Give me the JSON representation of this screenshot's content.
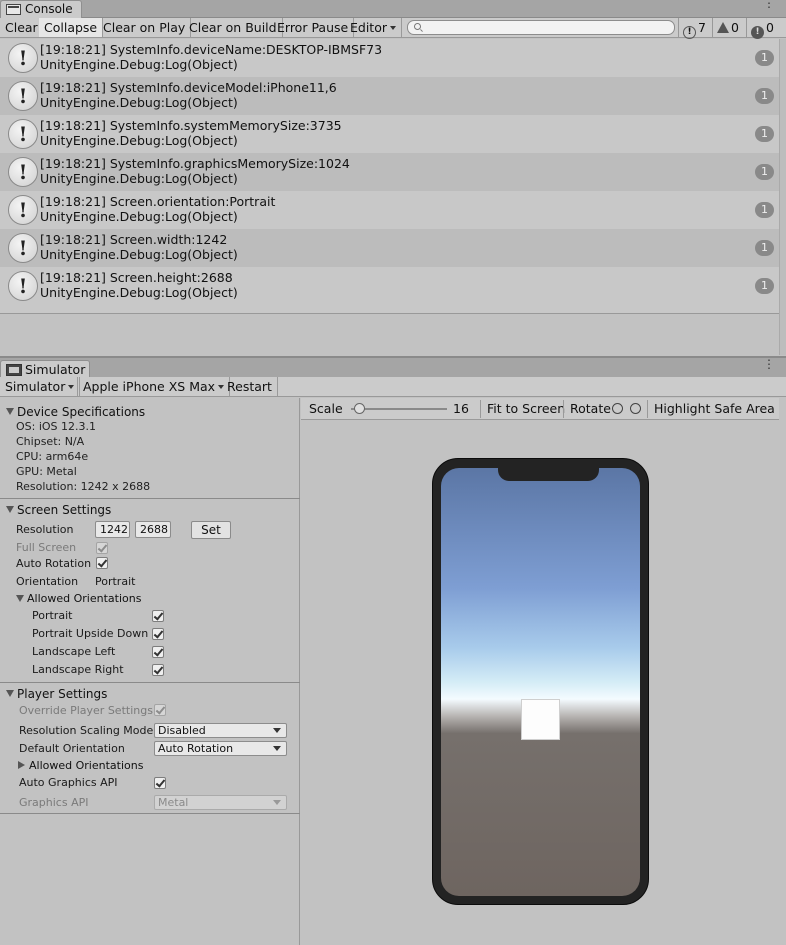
{
  "console": {
    "tab_label": "Console",
    "toolbar": {
      "clear": "Clear",
      "collapse": "Collapse",
      "clear_on_play": "Clear on Play",
      "clear_on_build": "Clear on Build",
      "error_pause": "Error Pause",
      "editor": "Editor",
      "search_placeholder": "",
      "log_count": "7",
      "warning_count": "0",
      "error_count": "0"
    },
    "logs": [
      {
        "line1": "[19:18:21] SystemInfo.deviceName:DESKTOP-IBMSF73",
        "line2": "UnityEngine.Debug:Log(Object)",
        "count": "1"
      },
      {
        "line1": "[19:18:21] SystemInfo.deviceModel:iPhone11,6",
        "line2": "UnityEngine.Debug:Log(Object)",
        "count": "1"
      },
      {
        "line1": "[19:18:21] SystemInfo.systemMemorySize:3735",
        "line2": "UnityEngine.Debug:Log(Object)",
        "count": "1"
      },
      {
        "line1": "[19:18:21] SystemInfo.graphicsMemorySize:1024",
        "line2": "UnityEngine.Debug:Log(Object)",
        "count": "1"
      },
      {
        "line1": "[19:18:21] Screen.orientation:Portrait",
        "line2": "UnityEngine.Debug:Log(Object)",
        "count": "1"
      },
      {
        "line1": "[19:18:21] Screen.width:1242",
        "line2": "UnityEngine.Debug:Log(Object)",
        "count": "1"
      },
      {
        "line1": "[19:18:21] Screen.height:2688",
        "line2": "UnityEngine.Debug:Log(Object)",
        "count": "1"
      }
    ]
  },
  "simulator": {
    "tab_label": "Simulator",
    "toolbar": {
      "mode": "Simulator",
      "device": "Apple iPhone XS Max",
      "restart": "Restart"
    },
    "device_specs": {
      "header": "Device Specifications",
      "os": "OS: iOS 12.3.1",
      "chipset": "Chipset: N/A",
      "cpu": "CPU: arm64e",
      "gpu": "GPU: Metal",
      "resolution": "Resolution: 1242 x 2688"
    },
    "screen_settings": {
      "header": "Screen Settings",
      "resolution_label": "Resolution",
      "res_width": "1242",
      "res_height": "2688",
      "set_button": "Set",
      "full_screen_label": "Full Screen",
      "auto_rotation_label": "Auto Rotation",
      "orientation_label": "Orientation",
      "orientation_value": "Portrait",
      "allowed_header": "Allowed Orientations",
      "portrait": "Portrait",
      "portrait_upside_down": "Portrait Upside Down",
      "landscape_left": "Landscape Left",
      "landscape_right": "Landscape Right"
    },
    "player_settings": {
      "header": "Player Settings",
      "override_label": "Override Player Settings",
      "scaling_label": "Resolution Scaling Mode",
      "scaling_value": "Disabled",
      "default_orientation_label": "Default Orientation",
      "default_orientation_value": "Auto Rotation",
      "allowed_header": "Allowed Orientations",
      "auto_graphics_label": "Auto Graphics API",
      "graphics_api_label": "Graphics API",
      "graphics_api_value": "Metal"
    },
    "viewport": {
      "scale_label": "Scale",
      "scale_value": "16",
      "fit_to_screen": "Fit to Screen",
      "rotate": "Rotate",
      "highlight_safe_area": "Highlight Safe Area"
    }
  }
}
